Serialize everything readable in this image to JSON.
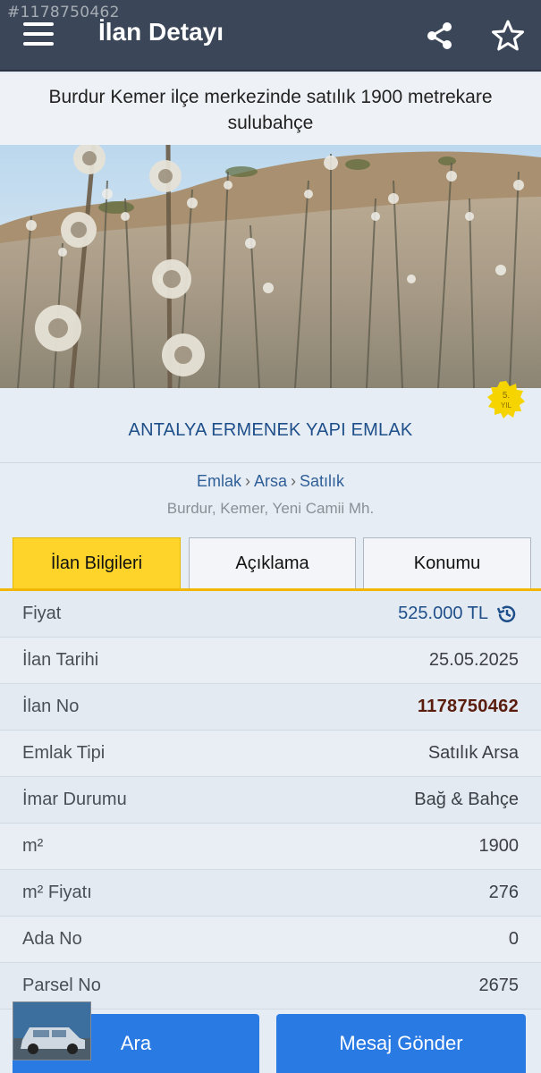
{
  "watermark": "#1178750462",
  "header": {
    "title": "İlan Detayı",
    "menu_icon": "hamburger-icon",
    "share_icon": "share-icon",
    "favorite_icon": "star-icon"
  },
  "listing": {
    "headline": "Burdur Kemer ilçe merkezinde satılık 1900 metrekare sulubahçe",
    "badge_text": "5. YIL",
    "store_name": "ANTALYA ERMENEK YAPI EMLAK",
    "breadcrumb": [
      "Emlak",
      "Arsa",
      "Satılık"
    ],
    "location": "Burdur, Kemer, Yeni Camii Mh."
  },
  "tabs": [
    {
      "label": "İlan Bilgileri",
      "active": true
    },
    {
      "label": "Açıklama",
      "active": false
    },
    {
      "label": "Konumu",
      "active": false
    }
  ],
  "details": [
    {
      "label": "Fiyat",
      "value": "525.000 TL"
    },
    {
      "label": "İlan Tarihi",
      "value": "25.05.2025"
    },
    {
      "label": "İlan No",
      "value": "1178750462"
    },
    {
      "label": "Emlak Tipi",
      "value": "Satılık Arsa"
    },
    {
      "label": "İmar Durumu",
      "value": "Bağ & Bahçe"
    },
    {
      "label": "m²",
      "value": "1900"
    },
    {
      "label": "m² Fiyatı",
      "value": "276"
    },
    {
      "label": "Ada No",
      "value": "0"
    },
    {
      "label": "Parsel No",
      "value": "2675"
    }
  ],
  "actions": {
    "call_label": "Ara",
    "message_label": "Mesaj Gönder"
  },
  "colors": {
    "topbar": "#3b4758",
    "accent_yellow": "#ffd42a",
    "primary_blue": "#2a7ae4",
    "link_blue": "#1f4f8a"
  }
}
